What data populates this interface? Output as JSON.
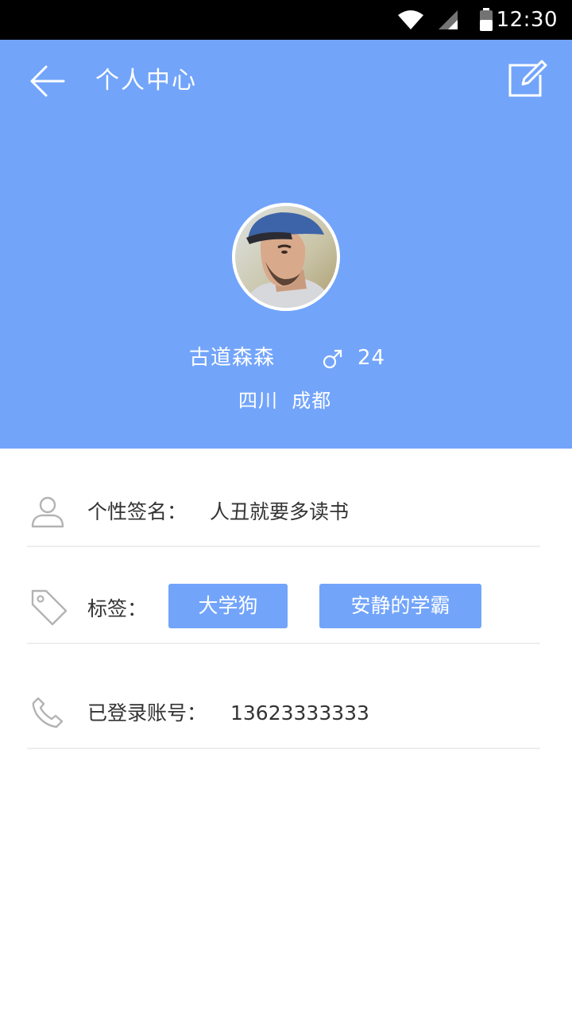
{
  "status_bar": {
    "time": "12:30",
    "icons": [
      "wifi-icon",
      "signal-icon",
      "battery-icon"
    ]
  },
  "header": {
    "title": "个人中心",
    "back_icon": "arrow-left-icon",
    "edit_icon": "edit-icon",
    "background_color": "#72a4fa"
  },
  "profile": {
    "name": "古道森森",
    "gender_symbol": "♂",
    "age": "24",
    "location": "四川  成都"
  },
  "info": {
    "signature": {
      "icon": "user-icon",
      "label": "个性签名：",
      "value": "人丑就要多读书"
    },
    "tags": {
      "icon": "tag-icon",
      "label": "标签：",
      "items": [
        "大学狗",
        "安静的学霸"
      ]
    },
    "account": {
      "icon": "phone-icon",
      "label": "已登录账号：",
      "value": "13623333333"
    }
  }
}
